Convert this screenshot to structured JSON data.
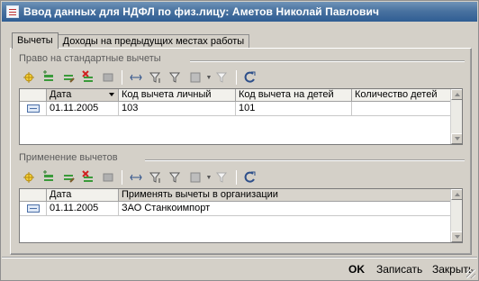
{
  "window": {
    "title": "Ввод данных для НДФЛ по физ.лицу: Аметов Николай Павлович"
  },
  "tabs": [
    {
      "label": "Вычеты",
      "active": true
    },
    {
      "label": "Доходы на предыдущих местах работы",
      "active": false
    }
  ],
  "standard_deductions": {
    "section_title": "Право на стандартные вычеты",
    "columns": [
      "Дата",
      "Код вычета личный",
      "Код вычета на детей",
      "Количество детей"
    ],
    "rows": [
      {
        "date": "01.11.2005",
        "personal_code": "103",
        "children_code": "101",
        "children_count": ""
      }
    ]
  },
  "applied_deductions": {
    "section_title": "Применение вычетов",
    "columns": [
      "Дата",
      "Применять вычеты в организации"
    ],
    "rows": [
      {
        "date": "01.11.2005",
        "organization": "ЗАО Станкоимпорт"
      }
    ]
  },
  "toolbar_icons": [
    "add-icon",
    "add-copy-icon",
    "edit-icon",
    "delete-icon",
    "mark-icon",
    "range-icon",
    "filter-icon",
    "filter-value-icon",
    "list-icon",
    "clear-filter-icon",
    "refresh-icon"
  ],
  "footer": {
    "ok_label": "OK",
    "save_label": "Записать",
    "close_label": "Закрыть"
  },
  "colors": {
    "title_bar": "#3f6a9e",
    "window_bg": "#d4d0c8",
    "grid_bg": "#ffffff",
    "section_text": "#5b5b5b"
  }
}
